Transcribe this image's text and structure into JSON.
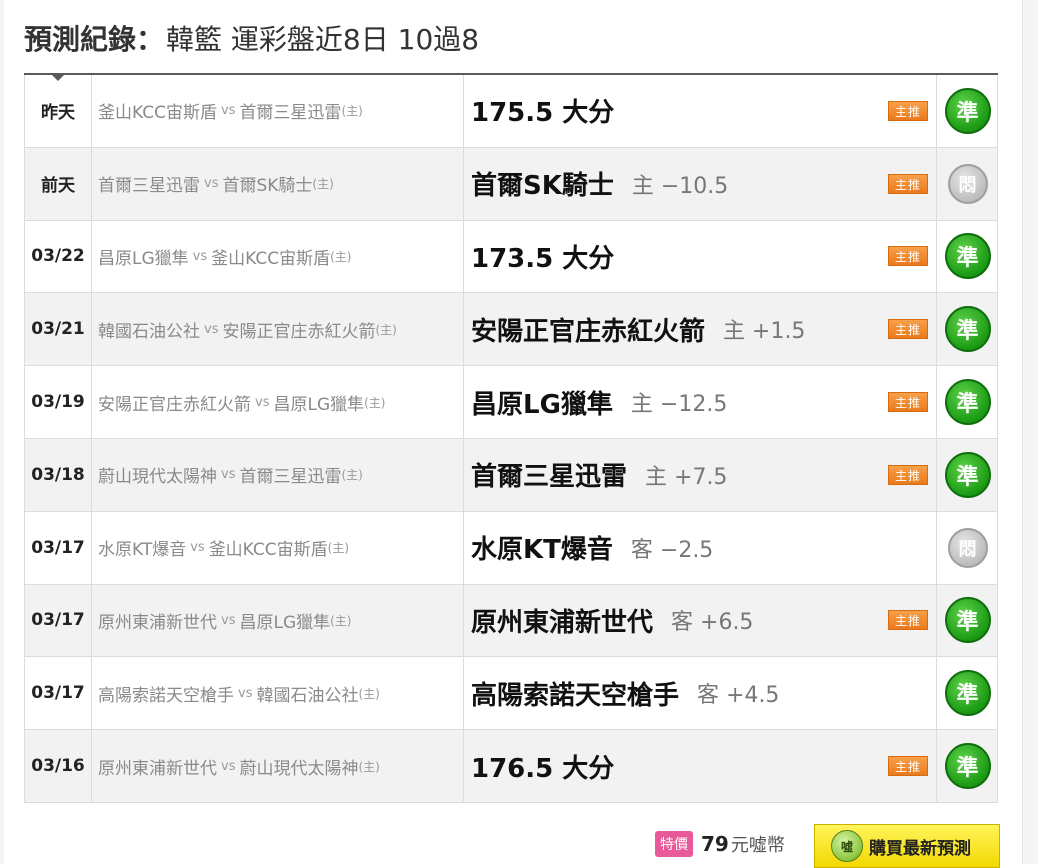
{
  "header": {
    "title_label": "預測紀錄",
    "colon": "：",
    "title_rest": "韓籃 運彩盤近8日 10過8"
  },
  "rows": [
    {
      "date": "昨天",
      "away": "釜山KCC宙斯盾",
      "vs": "vs",
      "home": "首爾三星迅雷",
      "home_tag": "(主)",
      "pick": "175.5 大分",
      "handicap": "",
      "badge": "主推",
      "result": "準"
    },
    {
      "date": "前天",
      "away": "首爾三星迅雷",
      "vs": "vs",
      "home": "首爾SK騎士",
      "home_tag": "(主)",
      "pick": "首爾SK騎士",
      "handicap": "主 −10.5",
      "badge": "主推",
      "result": "悶"
    },
    {
      "date": "03/22",
      "away": "昌原LG獵隼",
      "vs": "vs",
      "home": "釜山KCC宙斯盾",
      "home_tag": "(主)",
      "pick": "173.5 大分",
      "handicap": "",
      "badge": "主推",
      "result": "準"
    },
    {
      "date": "03/21",
      "away": "韓國石油公社",
      "vs": "vs",
      "home": "安陽正官庄赤紅火箭",
      "home_tag": "(主)",
      "pick": "安陽正官庄赤紅火箭",
      "handicap": "主 +1.5",
      "badge": "主推",
      "result": "準"
    },
    {
      "date": "03/19",
      "away": "安陽正官庄赤紅火箭",
      "vs": "vs",
      "home": "昌原LG獵隼",
      "home_tag": "(主)",
      "pick": "昌原LG獵隼",
      "handicap": "主 −12.5",
      "badge": "主推",
      "result": "準"
    },
    {
      "date": "03/18",
      "away": "蔚山現代太陽神",
      "vs": "vs",
      "home": "首爾三星迅雷",
      "home_tag": "(主)",
      "pick": "首爾三星迅雷",
      "handicap": "主 +7.5",
      "badge": "主推",
      "result": "準"
    },
    {
      "date": "03/17",
      "away": "水原KT爆音",
      "vs": "vs",
      "home": "釜山KCC宙斯盾",
      "home_tag": "(主)",
      "pick": "水原KT爆音",
      "handicap": "客 −2.5",
      "badge": "",
      "result": "悶"
    },
    {
      "date": "03/17",
      "away": "原州東浦新世代",
      "vs": "vs",
      "home": "昌原LG獵隼",
      "home_tag": "(主)",
      "pick": "原州東浦新世代",
      "handicap": "客 +6.5",
      "badge": "主推",
      "result": "準"
    },
    {
      "date": "03/17",
      "away": "高陽索諾天空槍手",
      "vs": "vs",
      "home": "韓國石油公社",
      "home_tag": "(主)",
      "pick": "高陽索諾天空槍手",
      "handicap": "客 +4.5",
      "badge": "",
      "result": "準"
    },
    {
      "date": "03/16",
      "away": "原州東浦新世代",
      "vs": "vs",
      "home": "蔚山現代太陽神",
      "home_tag": "(主)",
      "pick": "176.5 大分",
      "handicap": "",
      "badge": "主推",
      "result": "準"
    }
  ],
  "footer": {
    "special_tag": "特價",
    "price": "79",
    "unit": "元噓幣",
    "coin_text": "噓",
    "buy_label": "購買最新預測"
  },
  "colors": {
    "hit": "#1b9a14",
    "miss": "#bdbdbd",
    "badge": "#ea7a1c",
    "buy": "#f3d800",
    "special": "#e8599a"
  }
}
